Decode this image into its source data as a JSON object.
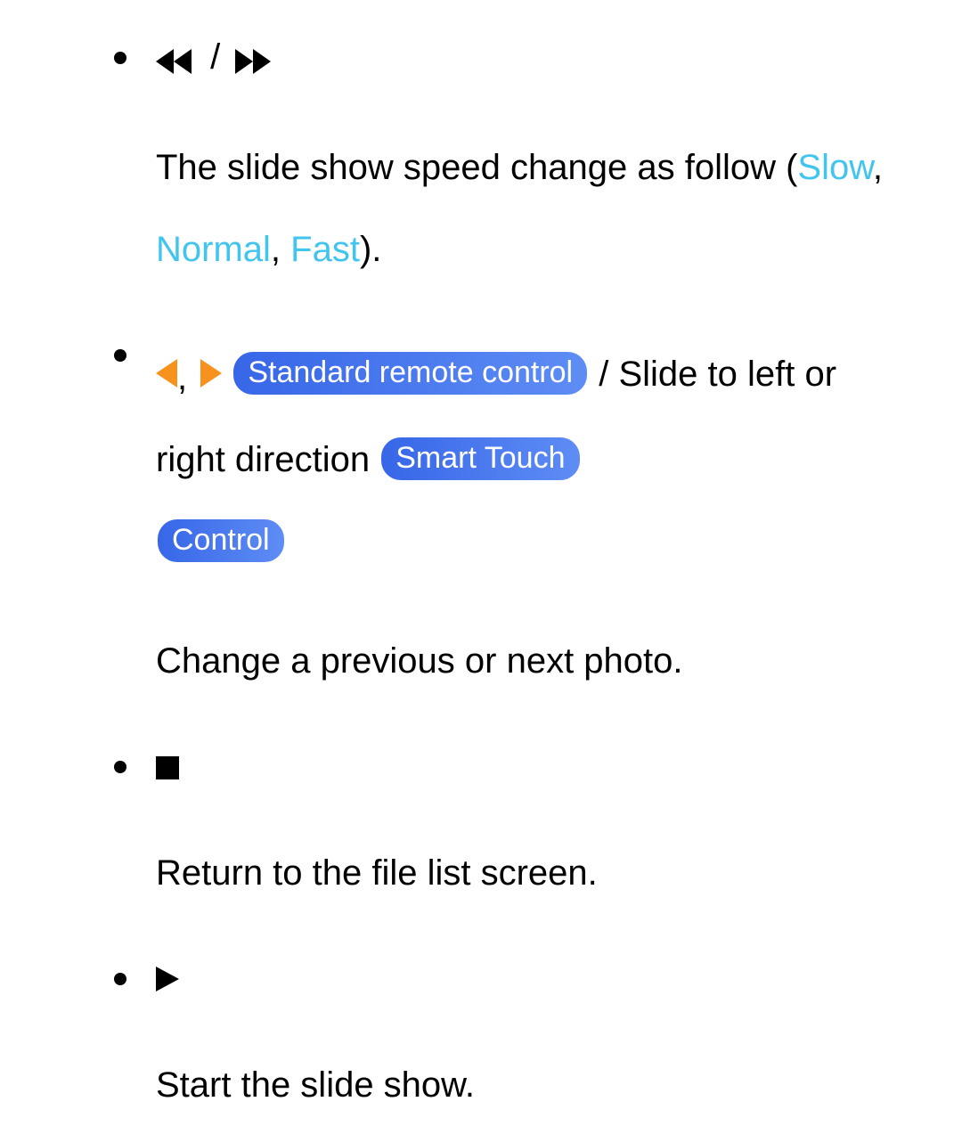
{
  "items": [
    {
      "slash": "/",
      "desc_a": "The slide show speed change as follow (",
      "speed_slow": "Slow",
      "desc_sep1": ", ",
      "speed_normal": "Normal",
      "desc_sep2": ", ",
      "speed_fast": "Fast",
      "desc_b": ")."
    },
    {
      "arrow_sep": ", ",
      "pill_standard": "Standard remote control",
      "slash_txt": " / ",
      "slide_txt_a": "Slide to left or right direction",
      "pill_smart_a": "Smart Touch",
      "pill_smart_b": "Control",
      "desc": "Change a previous or next photo."
    },
    {
      "desc": "Return to the file list screen."
    },
    {
      "desc": "Start the slide show."
    }
  ]
}
